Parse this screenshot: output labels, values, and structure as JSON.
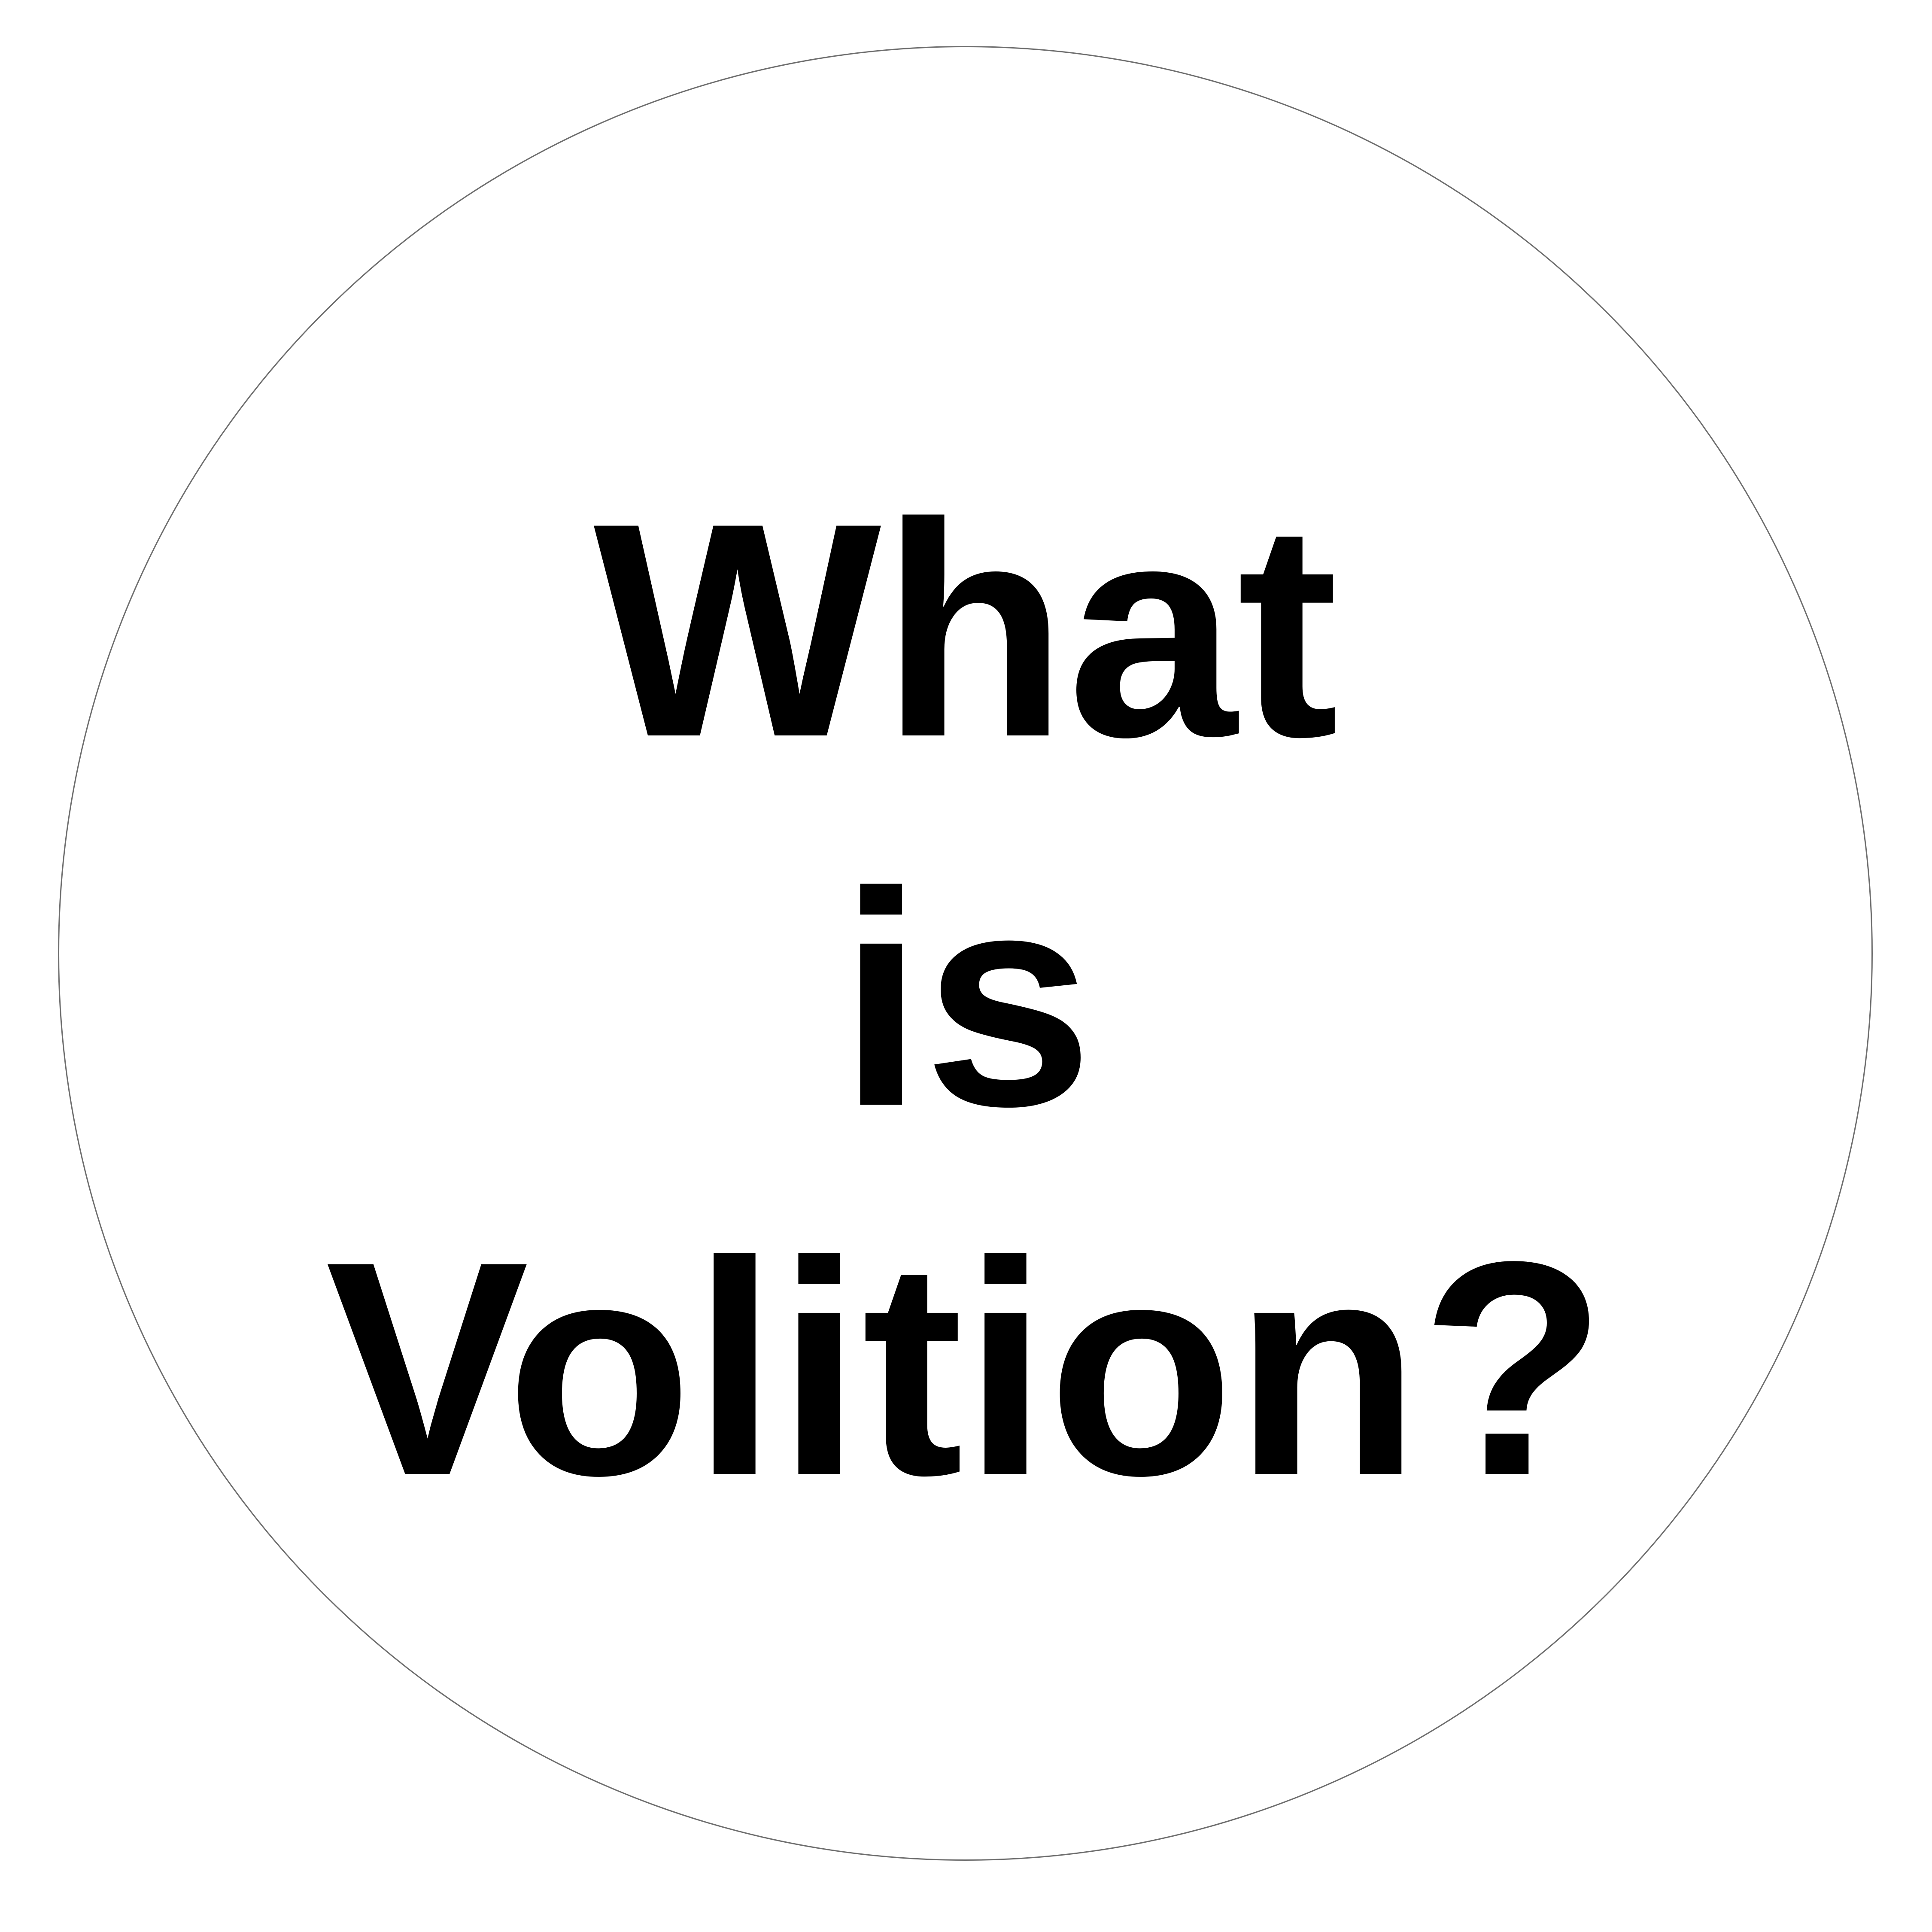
{
  "heading": {
    "line1": "What",
    "line2": "is",
    "line3": "Volition?"
  },
  "colors": {
    "text": "#000000",
    "background": "#ffffff",
    "circle_border": "#6e6e6e"
  }
}
